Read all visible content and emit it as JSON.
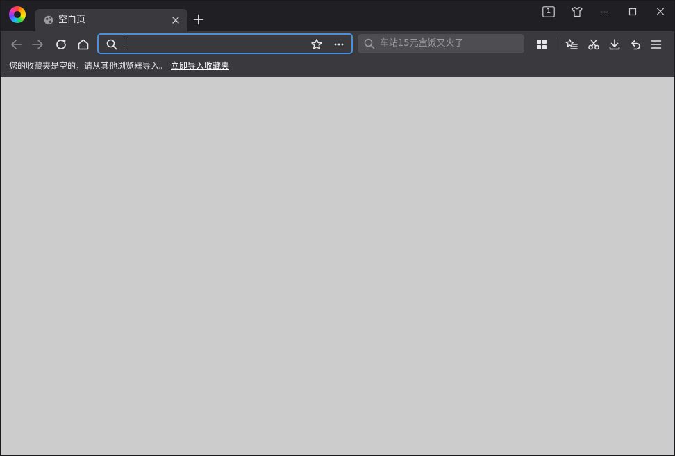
{
  "tab": {
    "title": "空白页"
  },
  "titlebar": {
    "tab_count": "1"
  },
  "address": {
    "value": "",
    "placeholder": ""
  },
  "search": {
    "placeholder": "车站15元盒饭又火了"
  },
  "bookmarks_bar": {
    "message": "您的收藏夹是空的，请从其他浏览器导入。",
    "import_link": "立即导入收藏夹"
  },
  "icons": {
    "logo": "browser-logo",
    "tab_favicon": "globe-icon",
    "tab_close": "close-icon",
    "new_tab": "plus-icon",
    "tab_counter": "tab-counter-icon",
    "skin": "shirt-icon",
    "minimize": "minimize-icon",
    "maximize": "maximize-icon",
    "close": "close-icon",
    "back": "arrow-left-icon",
    "forward": "arrow-right-icon",
    "reload": "reload-icon",
    "home": "home-icon",
    "url_search": "search-icon",
    "bookmark_star": "star-icon",
    "more": "more-icon",
    "apps": "apps-grid-icon",
    "favorites": "favorites-list-icon",
    "screenshot": "scissors-icon",
    "download": "download-icon",
    "undo": "undo-icon",
    "menu": "hamburger-menu-icon"
  },
  "colors": {
    "titlebar": "#202024",
    "toolbar": "#3a3a3e",
    "focus_border": "#4a90e2",
    "content": "#cccccc"
  }
}
